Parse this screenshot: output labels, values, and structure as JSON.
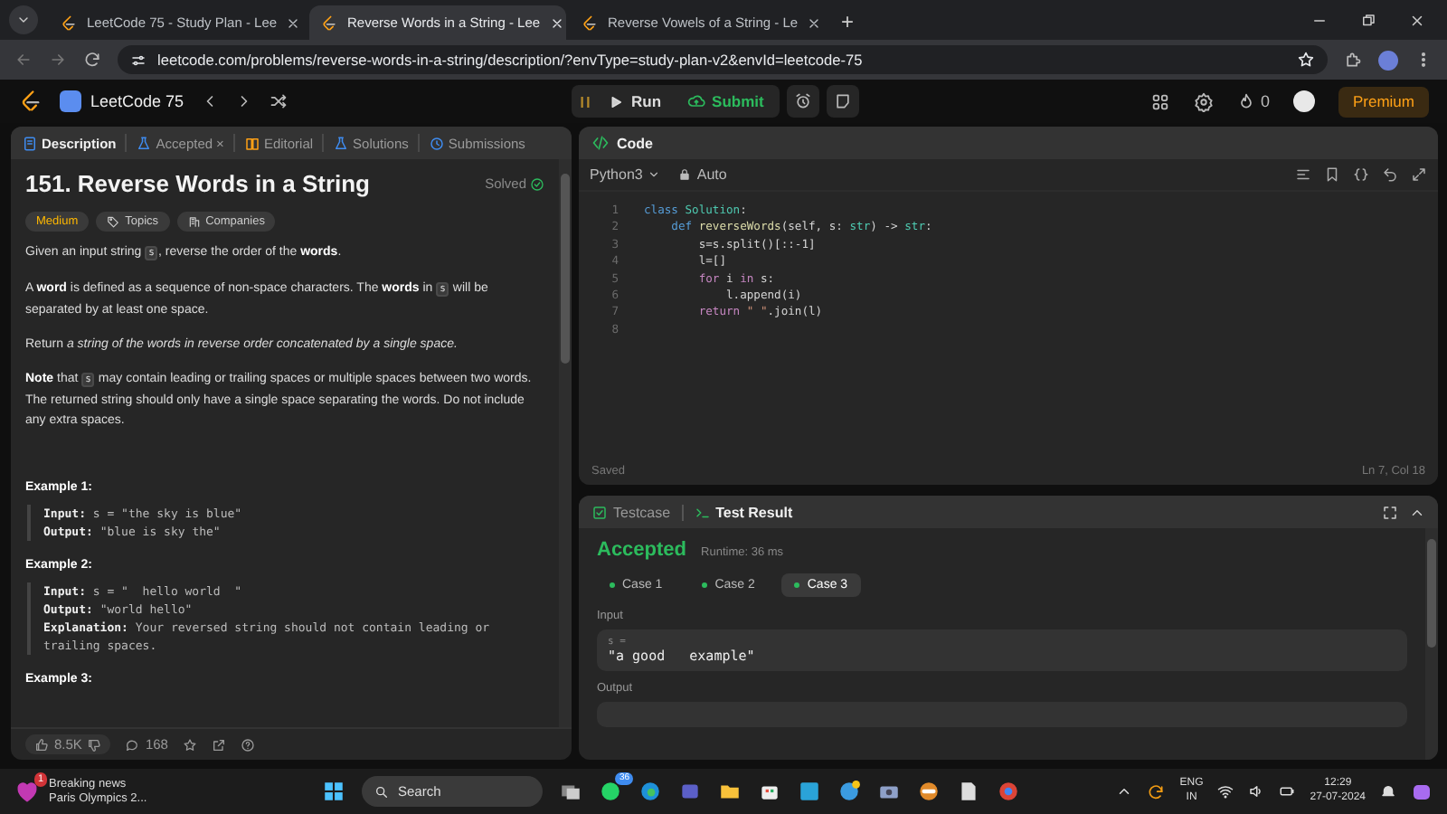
{
  "browser": {
    "tabs": [
      {
        "title": "LeetCode 75 - Study Plan - Lee",
        "selected": false
      },
      {
        "title": "Reverse Words in a String - Lee",
        "selected": true
      },
      {
        "title": "Reverse Vowels of a String - Le",
        "selected": false
      }
    ],
    "new_tab": "+",
    "url": "leetcode.com/problems/reverse-words-in-a-string/description/?envType=study-plan-v2&envId=leetcode-75"
  },
  "header": {
    "study_plan": "LeetCode 75",
    "run": "Run",
    "submit": "Submit",
    "streak": "0",
    "premium": "Premium"
  },
  "description_panel": {
    "tabs": [
      {
        "label": "Description",
        "selected": true
      },
      {
        "label": "Accepted",
        "selected": false,
        "close": "×"
      },
      {
        "label": "Editorial",
        "selected": false
      },
      {
        "label": "Solutions",
        "selected": false
      },
      {
        "label": "Submissions",
        "selected": false
      }
    ],
    "title": "151. Reverse Words in a String",
    "status": "Solved",
    "difficulty": "Medium",
    "tags": [
      "Topics",
      "Companies"
    ],
    "paragraphs": [
      [
        {
          "kind": "text",
          "text": "Given an input string "
        },
        {
          "kind": "code",
          "text": "s"
        },
        {
          "kind": "text",
          "text": ", reverse the order of the **words**."
        }
      ],
      [
        {
          "kind": "text",
          "text": "A **word** is defined as a sequence of non-space characters. The **words** in "
        },
        {
          "kind": "code",
          "text": "s"
        },
        {
          "kind": "text",
          "text": " will be separated by at least one space."
        }
      ],
      [
        {
          "kind": "text",
          "text": "Return *a string of the words in reverse order concatenated by a single space.*"
        }
      ],
      [
        {
          "kind": "text",
          "text": "**Note** that "
        },
        {
          "kind": "code",
          "text": "s"
        },
        {
          "kind": "text",
          "text": " may contain leading or trailing spaces or multiple spaces between two words. The returned string should only have a single space separating the words. Do not include any extra spaces."
        }
      ]
    ],
    "examples": [
      {
        "title": "Example 1:",
        "lines": [
          {
            "label": "Input:",
            "value": "s = \"the sky is blue\""
          },
          {
            "label": "Output:",
            "value": "\"blue is sky the\""
          }
        ]
      },
      {
        "title": "Example 2:",
        "lines": [
          {
            "label": "Input:",
            "value": "s = \"  hello world  \""
          },
          {
            "label": "Output:",
            "value": "\"world hello\""
          },
          {
            "label": "Explanation:",
            "value": "Your reversed string should not contain leading or trailing spaces."
          }
        ]
      },
      {
        "title": "Example 3:"
      }
    ],
    "likes": "8.5K",
    "comments": "168"
  },
  "code_panel": {
    "title": "Code",
    "language": "Python3",
    "mode": "Auto",
    "lines": [
      {
        "number": "1",
        "tokens": [
          {
            "kind": "keyword",
            "text": "class"
          },
          {
            "kind": "type",
            "text": " Solution"
          },
          {
            "kind": "plain",
            "text": ":"
          }
        ]
      },
      {
        "number": "2",
        "tokens": [
          {
            "kind": "keyword",
            "text": "    def"
          },
          {
            "kind": "function",
            "text": " reverseWords"
          },
          {
            "kind": "plain",
            "text": "(self, s: "
          },
          {
            "kind": "type",
            "text": "str"
          },
          {
            "kind": "plain",
            "text": ") -> "
          },
          {
            "kind": "type",
            "text": "str"
          },
          {
            "kind": "plain",
            "text": ":"
          }
        ]
      },
      {
        "number": "3",
        "tokens": [
          {
            "kind": "plain",
            "text": "        s=s.split()[::-1]"
          }
        ]
      },
      {
        "number": "4",
        "tokens": [
          {
            "kind": "plain",
            "text": "        l=[]"
          }
        ]
      },
      {
        "number": "5",
        "tokens": [
          {
            "kind": "control",
            "text": "        for"
          },
          {
            "kind": "plain",
            "text": " i "
          },
          {
            "kind": "control",
            "text": "in"
          },
          {
            "kind": "plain",
            "text": " s:"
          }
        ]
      },
      {
        "number": "6",
        "tokens": [
          {
            "kind": "plain",
            "text": "            l.append(i)"
          }
        ]
      },
      {
        "number": "7",
        "tokens": [
          {
            "kind": "control",
            "text": "        return"
          },
          {
            "kind": "string",
            "text": " \" \""
          },
          {
            "kind": "plain",
            "text": ".join(l)"
          }
        ]
      },
      {
        "number": "8"
      }
    ],
    "status": "Saved",
    "cursor": "Ln 7, Col 18"
  },
  "result_panel": {
    "tabs": [
      {
        "label": "Testcase",
        "selected": false
      },
      {
        "label": "Test Result",
        "selected": true
      }
    ],
    "verdict": "Accepted",
    "runtime": "Runtime: 36 ms",
    "cases": [
      {
        "label": "Case 1",
        "selected": false
      },
      {
        "label": "Case 2",
        "selected": false
      },
      {
        "label": "Case 3",
        "selected": true
      }
    ],
    "input_label": "Input",
    "input_var": "s =",
    "input_value": "\"a good   example\"",
    "output_label": "Output"
  },
  "taskbar": {
    "news_badge": "1",
    "news_title": "Breaking news",
    "news_subtitle": "Paris Olympics 2...",
    "search": "Search",
    "chat_badge": "36",
    "language": "ENG",
    "region": "IN",
    "time": "12:29",
    "date": "27-07-2024"
  }
}
